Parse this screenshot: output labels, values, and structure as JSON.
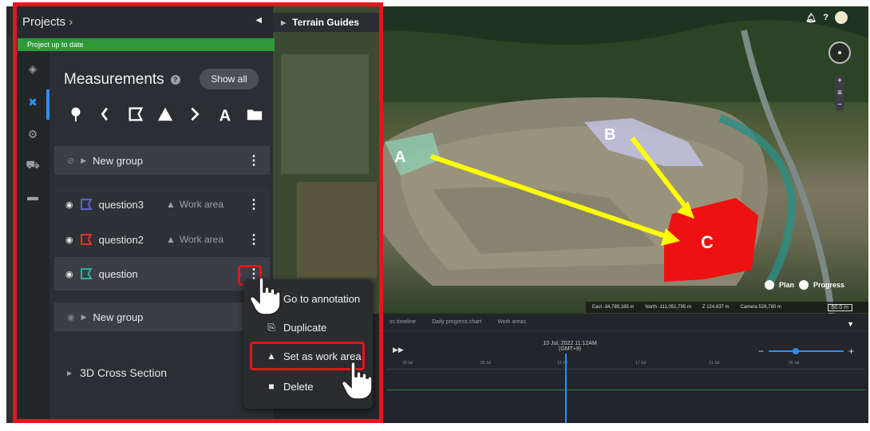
{
  "app": {
    "projects_label": "Projects",
    "status": "Project up to date",
    "terrain_guides": "Terrain Guides"
  },
  "measurements": {
    "title": "Measurements",
    "show_all": "Show all",
    "tools": [
      "pin-icon",
      "line-icon",
      "polygon-icon",
      "volume-icon",
      "polyline-icon",
      "text-icon",
      "folder-icon"
    ]
  },
  "groups": [
    {
      "label": "New group"
    },
    {
      "label": "New group"
    }
  ],
  "rows": [
    {
      "name": "question3",
      "color": "#5b63c9",
      "work_area": "Work area"
    },
    {
      "name": "question2",
      "color": "#e0332f",
      "work_area": "Work area"
    },
    {
      "name": "question",
      "color": "#2bb0a0",
      "work_area": "",
      "dash": "-"
    }
  ],
  "cross_section": "3D Cross Section",
  "menu": {
    "items": [
      "Go to annotation",
      "Duplicate",
      "Set as work area",
      "Delete"
    ]
  },
  "map": {
    "labels": [
      "A",
      "B",
      "C"
    ],
    "plan": "Plan",
    "progress": "Progress",
    "coords": {
      "east": "East -34,789,185 m",
      "north": "North -111,051,795 m",
      "z": "Z 124,637 m",
      "camera": "Camera 526,780 m",
      "scale": "50.0 m"
    }
  },
  "timeline": {
    "tabs": [
      "ss timeline",
      "Daily progress chart",
      "Work areas"
    ],
    "date": "13 Jul, 2022 11:12AM",
    "tz": "(GMT+9)",
    "ticks": [
      "30 Jul",
      "05 Jul",
      "13 Jul",
      "17 Jul",
      "21 Jul",
      "25 Jul"
    ]
  }
}
